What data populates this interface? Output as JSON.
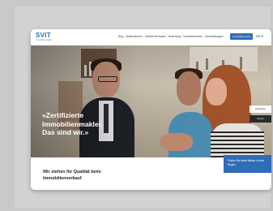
{
  "header": {
    "logo_text": "SVIT",
    "logo_subtitle": "Immobilienmakler",
    "nav": [
      "Blog",
      "Maklerkarriere",
      "Zertifizierte Makler",
      "Bewertung",
      "Immobilienmarkt",
      "Veranstaltungen"
    ],
    "cta_label": "Immobiliensuche",
    "language": "DE ▾"
  },
  "hero": {
    "headline": [
      "«Zertifizierte",
      "Immobilienmakler.",
      "Das sind wir.»"
    ],
    "side_tabs": [
      "Verkaufen",
      "Kaufen"
    ],
    "finder_text": "Finden Sie einen Makler in Ihrer Region",
    "finder_arrow": "→"
  },
  "section": {
    "heading": [
      "Wir stehen für Qualität beim",
      "Immobilienverkauf"
    ]
  },
  "colors": {
    "accent": "#2f6db8",
    "text": "#222222"
  }
}
